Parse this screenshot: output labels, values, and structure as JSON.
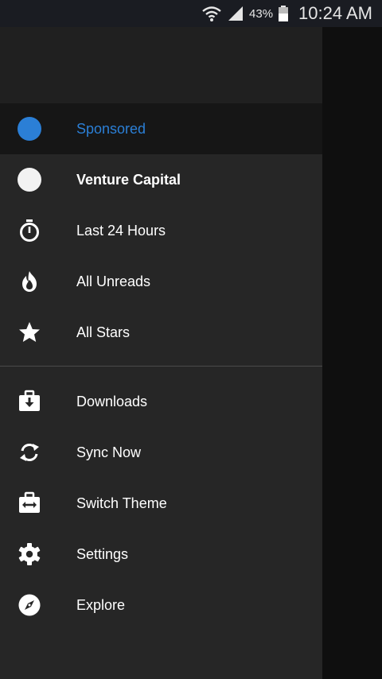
{
  "status_bar": {
    "battery": "43%",
    "time": "10:24 AM"
  },
  "menu": {
    "items": [
      {
        "label": "Sponsored",
        "icon": "blue-circle-icon",
        "color": "#2b7fd6"
      },
      {
        "label": "Venture Capital",
        "icon": "white-circle-icon"
      },
      {
        "label": "Last 24 Hours",
        "icon": "stopwatch-icon"
      },
      {
        "label": "All Unreads",
        "icon": "flame-icon"
      },
      {
        "label": "All Stars",
        "icon": "star-icon"
      },
      {
        "label": "Downloads",
        "icon": "download-briefcase-icon"
      },
      {
        "label": "Sync Now",
        "icon": "sync-icon"
      },
      {
        "label": "Switch Theme",
        "icon": "switch-theme-icon"
      },
      {
        "label": "Settings",
        "icon": "gear-icon"
      },
      {
        "label": "Explore",
        "icon": "compass-icon"
      }
    ]
  }
}
